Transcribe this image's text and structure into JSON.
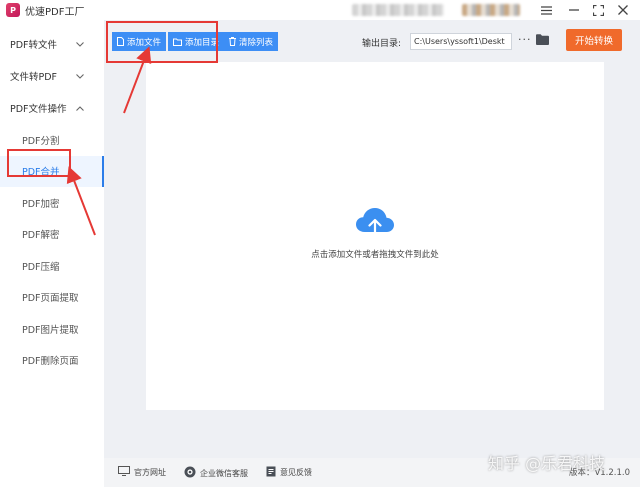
{
  "window": {
    "title": "优速PDF工厂",
    "logo_text": "P",
    "controls": [
      "menu-icon",
      "minimize-icon",
      "maximize-icon",
      "close-icon"
    ]
  },
  "sidebar": {
    "groups": [
      {
        "label": "PDF转文件",
        "chevron": "chevron-down-icon"
      },
      {
        "label": "文件转PDF",
        "chevron": "chevron-down-icon"
      },
      {
        "label": "PDF文件操作",
        "chevron": "chevron-up-icon"
      }
    ],
    "items": [
      {
        "label": "PDF分割",
        "active": false
      },
      {
        "label": "PDF合并",
        "active": true
      },
      {
        "label": "PDF加密",
        "active": false
      },
      {
        "label": "PDF解密",
        "active": false
      },
      {
        "label": "PDF压缩",
        "active": false
      },
      {
        "label": "PDF页面提取",
        "active": false
      },
      {
        "label": "PDF图片提取",
        "active": false
      },
      {
        "label": "PDF删除页面",
        "active": false
      }
    ]
  },
  "toolbar": {
    "add_file": "添加文件",
    "add_folder": "添加目录",
    "clear_list": "清除列表",
    "output_label": "输出目录:",
    "output_path": "C:\\Users\\yssoft1\\Deskt",
    "more": "···",
    "start": "开始转换"
  },
  "dropzone": {
    "hint": "点击添加文件或者拖拽文件到此处"
  },
  "footer": {
    "website": "官方网址",
    "wechat": "企业微信客服",
    "feedback": "意见反馈",
    "version": "版本：V1.2.1.0"
  },
  "watermark": "知乎 @乐君科技",
  "colors": {
    "accent": "#3d8ef5",
    "start_button": "#f06a2b",
    "highlight": "#e53935",
    "active_text": "#2b7de9"
  }
}
